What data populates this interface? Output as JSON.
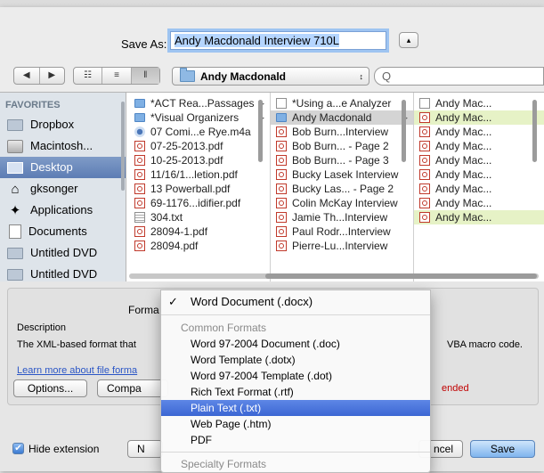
{
  "dialog": {
    "save_as_label": "Save As:",
    "filename_value": "Andy Macdonald Interview 710L",
    "expand_glyph": "▴"
  },
  "toolbar": {
    "nav_back_glyph": "◀",
    "nav_forward_glyph": "▶",
    "view_icons_glyph": "☷",
    "view_list_glyph": "≡",
    "view_columns_glyph": "‖",
    "location_label": "Andy Macdonald",
    "location_arrows": "↕",
    "search_glyph": "Q",
    "search_placeholder": ""
  },
  "sidebar": {
    "heading": "FAVORITES",
    "items": [
      {
        "label": "Dropbox",
        "icon": "folder-icon"
      },
      {
        "label": "Macintosh...",
        "icon": "hard-drive-icon"
      },
      {
        "label": "Desktop",
        "icon": "desktop-icon",
        "selected": true
      },
      {
        "label": "gksonger",
        "icon": "home-icon"
      },
      {
        "label": "Applications",
        "icon": "applications-icon"
      },
      {
        "label": "Documents",
        "icon": "documents-icon"
      },
      {
        "label": "Untitled DVD",
        "icon": "folder-icon"
      },
      {
        "label": "Untitled DVD",
        "icon": "folder-icon"
      }
    ]
  },
  "columns": {
    "col1": [
      {
        "name": "*ACT Rea...Passages",
        "kind": "folder",
        "arrow": "▶"
      },
      {
        "name": "*Visual Organizers",
        "kind": "folder",
        "arrow": "▶"
      },
      {
        "name": "07 Comi...e Rye.m4a",
        "kind": "audio"
      },
      {
        "name": "07-25-2013.pdf",
        "kind": "pdf"
      },
      {
        "name": "10-25-2013.pdf",
        "kind": "pdf"
      },
      {
        "name": "11/16/1...letion.pdf",
        "kind": "pdf"
      },
      {
        "name": "13 Powerball.pdf",
        "kind": "pdf"
      },
      {
        "name": "69-1176...idifier.pdf",
        "kind": "pdf"
      },
      {
        "name": "304.txt",
        "kind": "txt"
      },
      {
        "name": "28094-1.pdf",
        "kind": "pdf"
      },
      {
        "name": "28094.pdf",
        "kind": "pdf"
      }
    ],
    "col2": [
      {
        "name": "*Using a...e Analyzer",
        "kind": "doc"
      },
      {
        "name": "Andy Macdonald",
        "kind": "folder",
        "arrow": "▶",
        "selected": true
      },
      {
        "name": "Bob Burn...Interview",
        "kind": "pdf"
      },
      {
        "name": "Bob Burn... - Page 2",
        "kind": "pdf"
      },
      {
        "name": "Bob Burn... - Page 3",
        "kind": "pdf"
      },
      {
        "name": "Bucky Lasek Interview",
        "kind": "pdf"
      },
      {
        "name": "Bucky Las... - Page 2",
        "kind": "pdf"
      },
      {
        "name": "Colin McKay Interview",
        "kind": "pdf"
      },
      {
        "name": "Jamie Th...Interview",
        "kind": "pdf"
      },
      {
        "name": "Paul Rodr...Interview",
        "kind": "pdf"
      },
      {
        "name": "Pierre-Lu...Interview",
        "kind": "pdf"
      }
    ],
    "col3": [
      {
        "name": "Andy Mac...",
        "kind": "doc"
      },
      {
        "name": "Andy Mac...",
        "kind": "pdf",
        "highlight": true
      },
      {
        "name": "Andy Mac...",
        "kind": "pdf"
      },
      {
        "name": "Andy Mac...",
        "kind": "pdf"
      },
      {
        "name": "Andy Mac...",
        "kind": "pdf"
      },
      {
        "name": "Andy Mac...",
        "kind": "pdf"
      },
      {
        "name": "Andy Mac...",
        "kind": "pdf"
      },
      {
        "name": "Andy Mac...",
        "kind": "pdf"
      },
      {
        "name": "Andy Mac...",
        "kind": "pdf",
        "highlight": true
      }
    ]
  },
  "options_panel": {
    "format_label": "Forma",
    "description_label": "Description",
    "description_text": "The XML-based format that",
    "description_tail": "VBA macro code.",
    "learn_more": "Learn more about file forma",
    "warning_text": "ended",
    "options_button": "Options...",
    "compat_button": "Compa",
    "hide_extension_label": "Hide extension",
    "new_folder_button": "N",
    "cancel_button": "ncel",
    "save_button": "Save",
    "checkmark": "✔"
  },
  "format_menu": {
    "selected_item": "Word Document (.docx)",
    "check_glyph": "✓",
    "common_header": "Common Formats",
    "items": [
      "Word 97-2004 Document (.doc)",
      "Word Template (.dotx)",
      "Word 97-2004 Template (.dot)",
      "Rich Text Format (.rtf)",
      "Plain Text (.txt)",
      "Web Page (.htm)",
      "PDF"
    ],
    "highlighted_index": 4,
    "specialty_header": "Specialty Formats"
  }
}
